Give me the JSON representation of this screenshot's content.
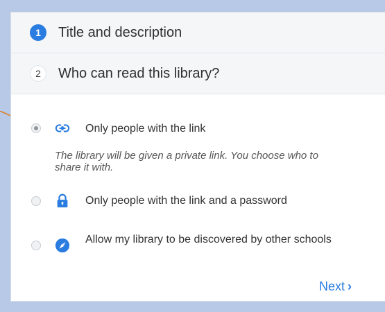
{
  "steps": [
    {
      "number": "1",
      "title": "Title and description"
    },
    {
      "number": "2",
      "title": "Who can read this library?"
    }
  ],
  "options": [
    {
      "label": "Only people with the link",
      "description": "The library will be given a private link. You choose who to share it with.",
      "selected": true,
      "icon": "link-icon"
    },
    {
      "label": "Only people with the link and a password",
      "selected": false,
      "icon": "lock-icon"
    },
    {
      "label": "Allow my library to be discovered by other schools",
      "selected": false,
      "icon": "compass-icon"
    }
  ],
  "next_label": "Next",
  "colors": {
    "accent": "#2a7ce0",
    "annotation_arrow": "#e07a1f",
    "background": "#b7c9e6"
  }
}
